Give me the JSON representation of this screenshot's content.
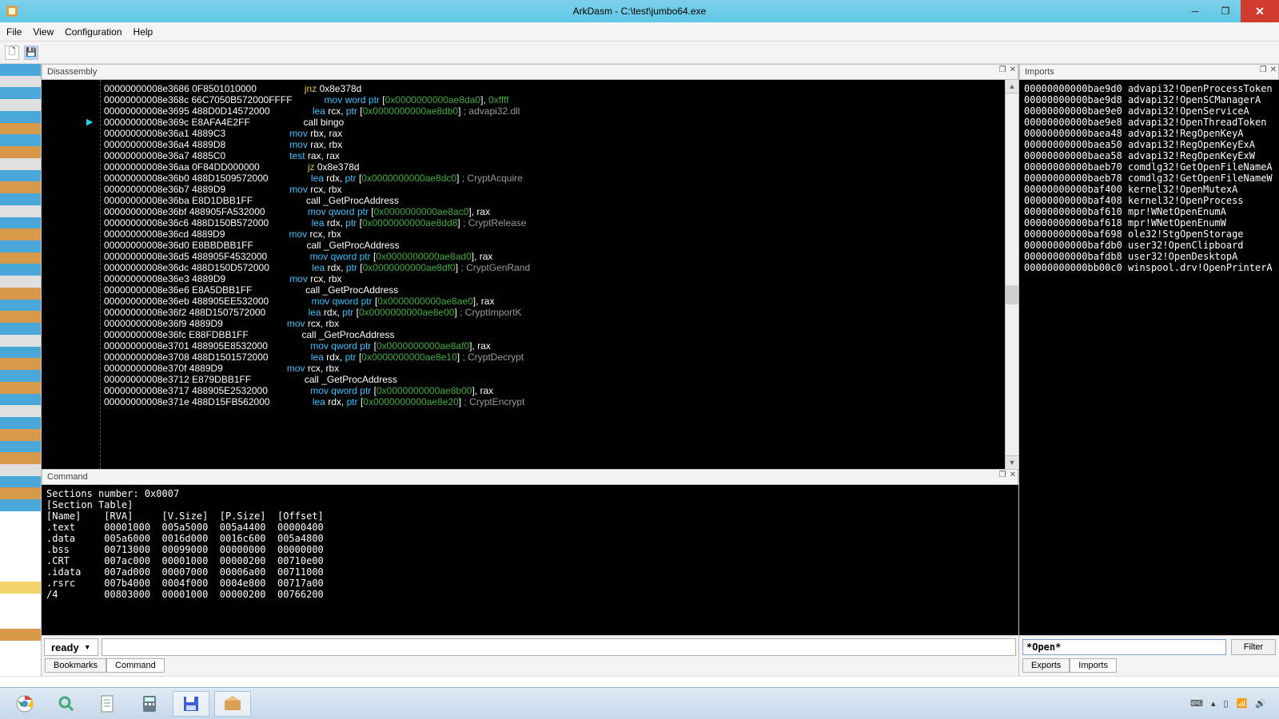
{
  "window": {
    "title": "ArkDasm - C:\\test\\jumbo64.exe"
  },
  "menubar": [
    "File",
    "View",
    "Configuration",
    "Help"
  ],
  "panels": {
    "disasm": "Disassembly",
    "imports": "Imports",
    "command": "Command"
  },
  "filter": {
    "value": "*Open*",
    "button": "Filter"
  },
  "ie_tabs": [
    "Exports",
    "Imports"
  ],
  "cmd": {
    "ready": "ready"
  },
  "bk_tabs": [
    "Bookmarks",
    "Command"
  ],
  "imports_lines": [
    "00000000000bae9d0 advapi32!OpenProcessToken",
    "00000000000bae9d8 advapi32!OpenSCManagerA",
    "00000000000bae9e0 advapi32!OpenServiceA",
    "00000000000bae9e8 advapi32!OpenThreadToken",
    "00000000000baea48 advapi32!RegOpenKeyA",
    "00000000000baea50 advapi32!RegOpenKeyExA",
    "00000000000baea58 advapi32!RegOpenKeyExW",
    "00000000000baeb70 comdlg32!GetOpenFileNameA",
    "00000000000baeb78 comdlg32!GetOpenFileNameW",
    "00000000000baf400 kernel32!OpenMutexA",
    "00000000000baf408 kernel32!OpenProcess",
    "00000000000baf610 mpr!WNetOpenEnumA",
    "00000000000baf618 mpr!WNetOpenEnumW",
    "00000000000baf698 ole32!StgOpenStorage",
    "00000000000bafdb0 user32!OpenClipboard",
    "00000000000bafdb8 user32!OpenDesktopA",
    "00000000000bb00c0 winspool.drv!OpenPrinterA"
  ],
  "cmd_lines": [
    "Sections number: 0x0007",
    "[Section Table]",
    "[Name]    [RVA]     [V.Size]  [P.Size]  [Offset]",
    ".text     00001000  005a5000  005a4400  00000400",
    ".data     005a6000  0016d000  0016c600  005a4800",
    ".bss      00713000  00099000  00000000  00000000",
    ".CRT      007ac000  00001000  00000200  00710e00",
    ".idata    007ad000  00007000  00006a00  00711000",
    ".rsrc     007b4000  0004f000  0004e800  00717a00",
    "/4        00803000  00001000  00000200  00766200"
  ],
  "disasm": [
    {
      "addr": "00000000008e3686",
      "hex": "0F8501010000",
      "mn": "jnz",
      "mcls": "y",
      "rest": " 0x8e378d"
    },
    {
      "addr": "00000000008e368c",
      "hex": "66C7050B572000FFFF",
      "mn": "mov",
      "mcls": "b",
      "rest": " <span class='kw'>word ptr</span> [<span class='num'>0x0000000000ae8da0</span>], <span class='num'>0xffff</span>"
    },
    {
      "addr": "00000000008e3695",
      "hex": "488D0D14572000",
      "mn": "lea",
      "mcls": "b",
      "rest": " <span class='mn-w'>rcx</span>, <span class='kw'>ptr</span> [<span class='num'>0x0000000000ae8db0</span>] <span class='cmt'>; advapi32.dll</span>"
    },
    {
      "addr": "00000000008e369c",
      "hex": "E8AFA4E2FF",
      "mn": "call",
      "mcls": "w",
      "rest": " bingo",
      "cursor": true
    },
    {
      "addr": "00000000008e36a1",
      "hex": "4889C3",
      "mn": "mov",
      "mcls": "b",
      "rest": " <span class='mn-w'>rbx</span>, <span class='mn-w'>rax</span>"
    },
    {
      "addr": "00000000008e36a4",
      "hex": "4889D8",
      "mn": "mov",
      "mcls": "b",
      "rest": " <span class='mn-w'>rax</span>, <span class='mn-w'>rbx</span>"
    },
    {
      "addr": "00000000008e36a7",
      "hex": "4885C0",
      "mn": "test",
      "mcls": "b",
      "rest": " <span class='mn-w'>rax</span>, <span class='mn-w'>rax</span>"
    },
    {
      "addr": "00000000008e36aa",
      "hex": "0F84DD000000",
      "mn": "jz",
      "mcls": "y",
      "rest": " 0x8e378d"
    },
    {
      "addr": "00000000008e36b0",
      "hex": "488D1509572000",
      "mn": "lea",
      "mcls": "b",
      "rest": " <span class='mn-w'>rdx</span>, <span class='kw'>ptr</span> [<span class='num'>0x0000000000ae8dc0</span>] <span class='cmt'>; CryptAcquire</span>"
    },
    {
      "addr": "00000000008e36b7",
      "hex": "4889D9",
      "mn": "mov",
      "mcls": "b",
      "rest": " <span class='mn-w'>rcx</span>, <span class='mn-w'>rbx</span>"
    },
    {
      "addr": "00000000008e36ba",
      "hex": "E8D1DBB1FF",
      "mn": "call",
      "mcls": "w",
      "rest": " _GetProcAddress"
    },
    {
      "addr": "00000000008e36bf",
      "hex": "488905FA532000",
      "mn": "mov",
      "mcls": "b",
      "rest": " <span class='kw'>qword ptr</span> [<span class='num'>0x0000000000ae8ac0</span>], <span class='mn-w'>rax</span>"
    },
    {
      "addr": "00000000008e36c6",
      "hex": "488D150B572000",
      "mn": "lea",
      "mcls": "b",
      "rest": " <span class='mn-w'>rdx</span>, <span class='kw'>ptr</span> [<span class='num'>0x0000000000ae8dd8</span>] <span class='cmt'>; CryptRelease</span>"
    },
    {
      "addr": "00000000008e36cd",
      "hex": "4889D9",
      "mn": "mov",
      "mcls": "b",
      "rest": " <span class='mn-w'>rcx</span>, <span class='mn-w'>rbx</span>"
    },
    {
      "addr": "00000000008e36d0",
      "hex": "E8BBDBB1FF",
      "mn": "call",
      "mcls": "w",
      "rest": " _GetProcAddress"
    },
    {
      "addr": "00000000008e36d5",
      "hex": "488905F4532000",
      "mn": "mov",
      "mcls": "b",
      "rest": " <span class='kw'>qword ptr</span> [<span class='num'>0x0000000000ae8ad0</span>], <span class='mn-w'>rax</span>"
    },
    {
      "addr": "00000000008e36dc",
      "hex": "488D150D572000",
      "mn": "lea",
      "mcls": "b",
      "rest": " <span class='mn-w'>rdx</span>, <span class='kw'>ptr</span> [<span class='num'>0x0000000000ae8df0</span>] <span class='cmt'>; CryptGenRand</span>"
    },
    {
      "addr": "00000000008e36e3",
      "hex": "4889D9",
      "mn": "mov",
      "mcls": "b",
      "rest": " <span class='mn-w'>rcx</span>, <span class='mn-w'>rbx</span>"
    },
    {
      "addr": "00000000008e36e6",
      "hex": "E8A5DBB1FF",
      "mn": "call",
      "mcls": "w",
      "rest": " _GetProcAddress"
    },
    {
      "addr": "00000000008e36eb",
      "hex": "488905EE532000",
      "mn": "mov",
      "mcls": "b",
      "rest": " <span class='kw'>qword ptr</span> [<span class='num'>0x0000000000ae8ae0</span>], <span class='mn-w'>rax</span>"
    },
    {
      "addr": "00000000008e36f2",
      "hex": "488D1507572000",
      "mn": "lea",
      "mcls": "b",
      "rest": " <span class='mn-w'>rdx</span>, <span class='kw'>ptr</span> [<span class='num'>0x0000000000ae8e00</span>] <span class='cmt'>; CryptImportK</span>"
    },
    {
      "addr": "00000000008e36f9",
      "hex": "4889D9",
      "mn": "mov",
      "mcls": "b",
      "rest": " <span class='mn-w'>rcx</span>, <span class='mn-w'>rbx</span>"
    },
    {
      "addr": "00000000008e36fc",
      "hex": "E88FDBB1FF",
      "mn": "call",
      "mcls": "w",
      "rest": " _GetProcAddress"
    },
    {
      "addr": "00000000008e3701",
      "hex": "488905E8532000",
      "mn": "mov",
      "mcls": "b",
      "rest": " <span class='kw'>qword ptr</span> [<span class='num'>0x0000000000ae8af0</span>], <span class='mn-w'>rax</span>"
    },
    {
      "addr": "00000000008e3708",
      "hex": "488D1501572000",
      "mn": "lea",
      "mcls": "b",
      "rest": " <span class='mn-w'>rdx</span>, <span class='kw'>ptr</span> [<span class='num'>0x0000000000ae8e10</span>] <span class='cmt'>; CryptDecrypt</span>"
    },
    {
      "addr": "00000000008e370f",
      "hex": "4889D9",
      "mn": "mov",
      "mcls": "b",
      "rest": " <span class='mn-w'>rcx</span>, <span class='mn-w'>rbx</span>"
    },
    {
      "addr": "00000000008e3712",
      "hex": "E879DBB1FF",
      "mn": "call",
      "mcls": "w",
      "rest": " _GetProcAddress"
    },
    {
      "addr": "00000000008e3717",
      "hex": "488905E2532000",
      "mn": "mov",
      "mcls": "b",
      "rest": " <span class='kw'>qword ptr</span> [<span class='num'>0x0000000000ae8b00</span>], <span class='mn-w'>rax</span>"
    },
    {
      "addr": "00000000008e371e",
      "hex": "488D15FB562000",
      "mn": "lea",
      "mcls": "b",
      "rest": " <span class='mn-w'>rdx</span>, <span class='kw'>ptr</span> [<span class='num'>0x0000000000ae8e20</span>] <span class='cmt'>; CryptEncrypt</span>"
    }
  ],
  "map_stripes": [
    "#4aa8d8",
    "#e0e0e0",
    "#4aa8d8",
    "#e0e0e0",
    "#4aa8d8",
    "#d89a4a",
    "#4aa8d8",
    "#d89a4a",
    "#e0e0e0",
    "#4aa8d8",
    "#d89a4a",
    "#4aa8d8",
    "#e0e0e0",
    "#4aa8d8",
    "#d89a4a",
    "#4aa8d8",
    "#d89a4a",
    "#4aa8d8",
    "#e0e0e0",
    "#d89a4a",
    "#4aa8d8",
    "#d89a4a",
    "#4aa8d8",
    "#e0e0e0",
    "#4aa8d8",
    "#d89a4a",
    "#4aa8d8",
    "#d89a4a",
    "#4aa8d8",
    "#e0e0e0",
    "#4aa8d8",
    "#d89a4a",
    "#4aa8d8",
    "#d89a4a",
    "#e0e0e0",
    "#4aa8d8",
    "#d89a4a",
    "#4aa8d8",
    "#ffffff",
    "#ffffff",
    "#ffffff",
    "#ffffff",
    "#ffffff",
    "#ffffff",
    "#f4d36a",
    "#ffffff",
    "#ffffff",
    "#ffffff",
    "#d89a4a",
    "#ffffff",
    "#ffffff",
    "#ffffff"
  ]
}
